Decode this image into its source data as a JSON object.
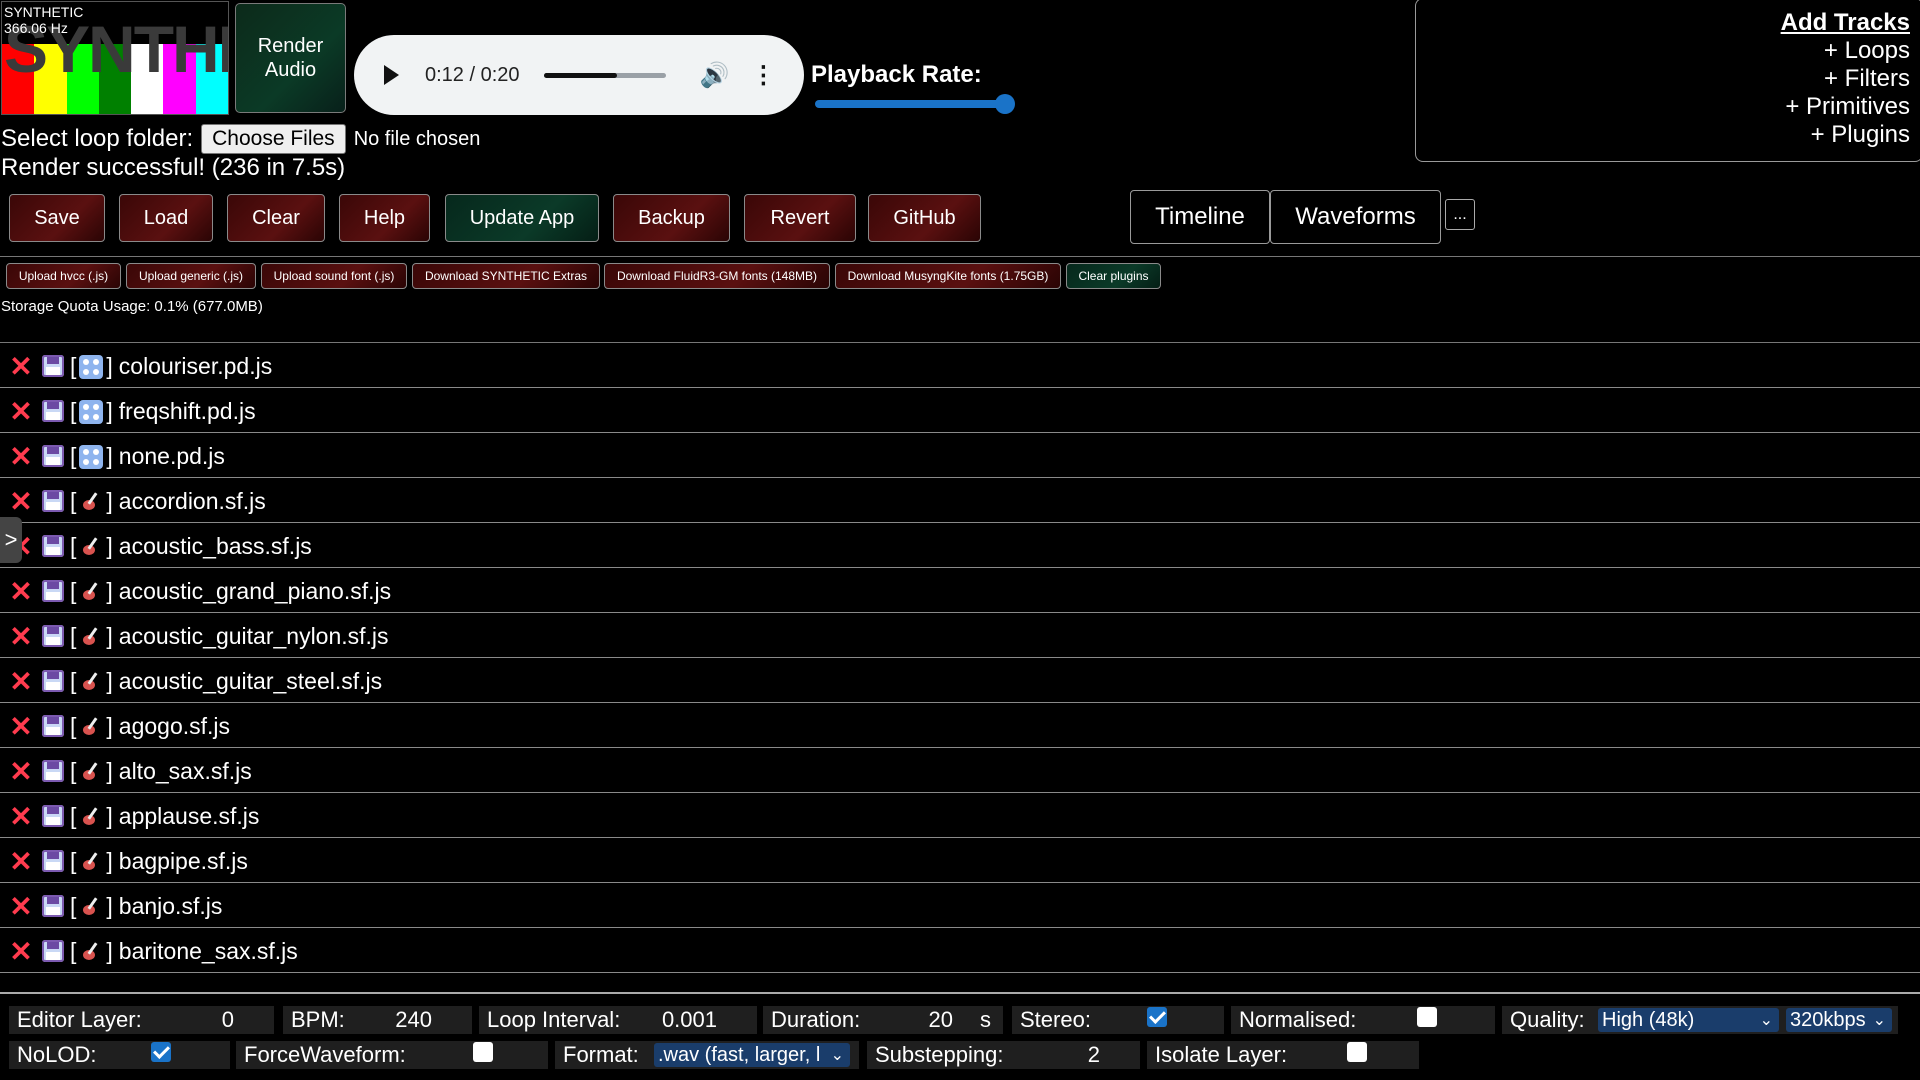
{
  "logo": {
    "word": "SYNTHETIC",
    "freq": "366.06 Hz",
    "bar_colors": [
      "#ff0000",
      "#ffff00",
      "#00ff00",
      "#008000",
      "#ffffff",
      "#ff00ff",
      "#00ffff"
    ]
  },
  "render_button": "Render Audio",
  "audio": {
    "time": "0:12 / 0:20",
    "progress": 0.6
  },
  "playback": {
    "label": "Playback Rate:",
    "value_fraction": 1.0
  },
  "add_tracks": {
    "title": "Add Tracks",
    "items": [
      "+ Loops",
      "+ Filters",
      "+ Primitives",
      "+ Plugins"
    ]
  },
  "folder": {
    "label": "Select loop folder:",
    "button": "Choose Files",
    "status": "No file chosen"
  },
  "render_status": "Render successful! (236 in 7.5s)",
  "toolbar": {
    "save": "Save",
    "load": "Load",
    "clear": "Clear",
    "help": "Help",
    "update": "Update App",
    "backup": "Backup",
    "revert": "Revert",
    "github": "GitHub"
  },
  "views": {
    "timeline": "Timeline",
    "waveforms": "Waveforms",
    "more": "..."
  },
  "small_buttons": [
    "Upload hvcc (.js)",
    "Upload generic (.js)",
    "Upload sound font (.js)",
    "Download SYNTHETIC Extras",
    "Download FluidR3-GM fonts (148MB)",
    "Download MusyngKite fonts (1.75GB)",
    "Clear plugins"
  ],
  "storage": "Storage Quota Usage: 0.1% (677.0MB)",
  "side_toggle": ">",
  "plugins": [
    {
      "type": "dice",
      "name": "colouriser.pd.js"
    },
    {
      "type": "dice",
      "name": "freqshift.pd.js"
    },
    {
      "type": "dice",
      "name": "none.pd.js"
    },
    {
      "type": "guitar",
      "name": "accordion.sf.js"
    },
    {
      "type": "guitar",
      "name": "acoustic_bass.sf.js"
    },
    {
      "type": "guitar",
      "name": "acoustic_grand_piano.sf.js"
    },
    {
      "type": "guitar",
      "name": "acoustic_guitar_nylon.sf.js"
    },
    {
      "type": "guitar",
      "name": "acoustic_guitar_steel.sf.js"
    },
    {
      "type": "guitar",
      "name": "agogo.sf.js"
    },
    {
      "type": "guitar",
      "name": "alto_sax.sf.js"
    },
    {
      "type": "guitar",
      "name": "applause.sf.js"
    },
    {
      "type": "guitar",
      "name": "bagpipe.sf.js"
    },
    {
      "type": "guitar",
      "name": "banjo.sf.js"
    },
    {
      "type": "guitar",
      "name": "baritone_sax.sf.js"
    }
  ],
  "settings": {
    "editor_layer": {
      "label": "Editor Layer:",
      "value": "0"
    },
    "bpm": {
      "label": "BPM:",
      "value": "240"
    },
    "loop_interval": {
      "label": "Loop Interval:",
      "value": "0.001"
    },
    "duration": {
      "label": "Duration:",
      "value": "20",
      "unit": "s"
    },
    "stereo": {
      "label": "Stereo:",
      "checked": true
    },
    "normalised": {
      "label": "Normalised:",
      "checked": false
    },
    "quality": {
      "label": "Quality:",
      "value": "High (48k)",
      "bitrate": "320kbps"
    },
    "nolod": {
      "label": "NoLOD:",
      "checked": true
    },
    "force_waveform": {
      "label": "ForceWaveform:",
      "checked": false
    },
    "format": {
      "label": "Format:",
      "value": ".wav (fast, larger, l"
    },
    "substepping": {
      "label": "Substepping:",
      "value": "2"
    },
    "isolate_layer": {
      "label": "Isolate Layer:",
      "checked": false
    }
  }
}
